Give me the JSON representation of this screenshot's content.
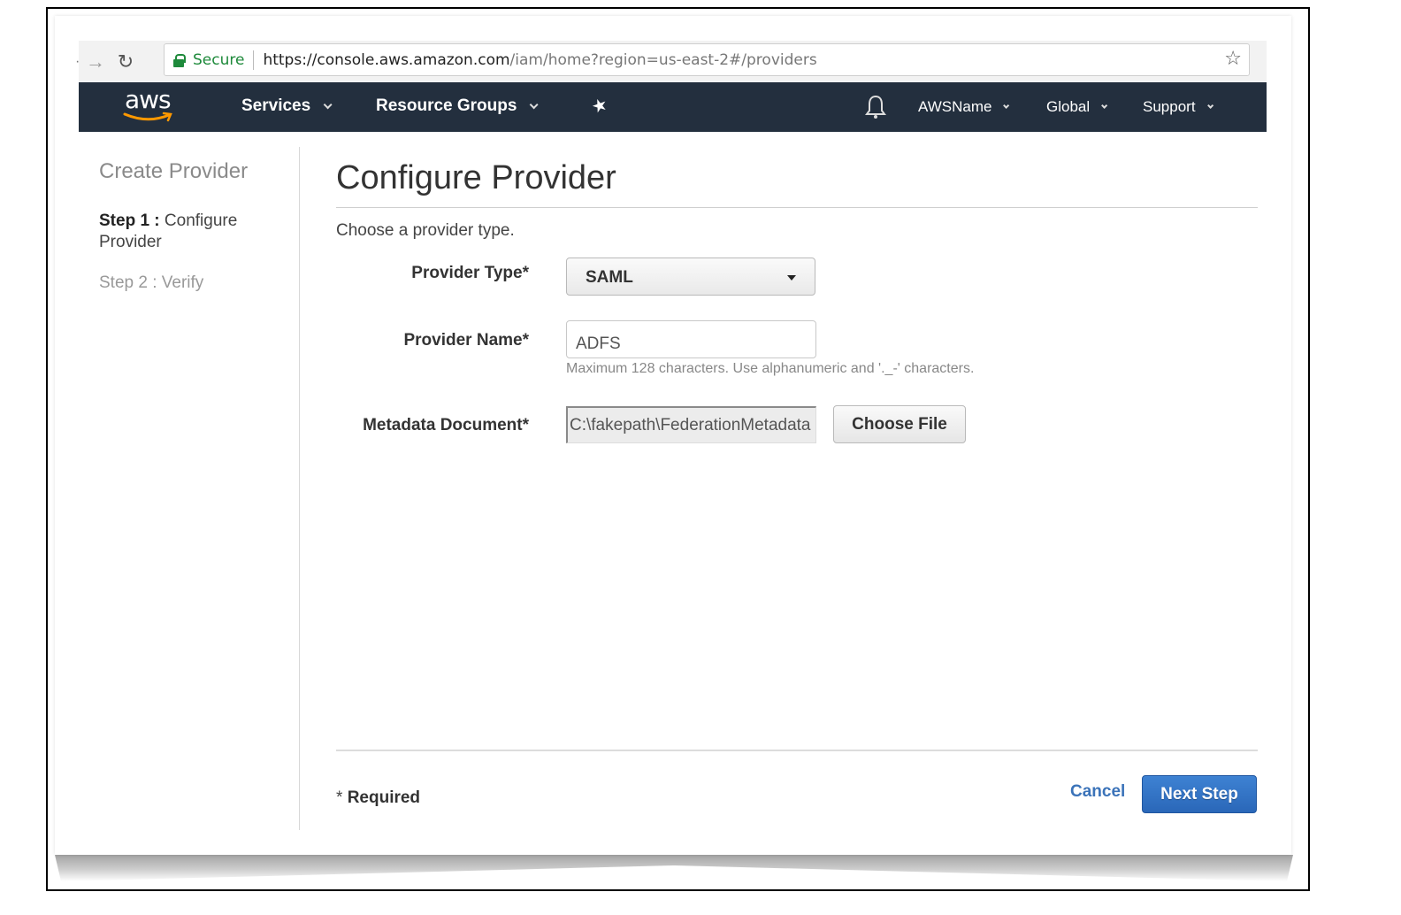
{
  "browser": {
    "secure_label": "Secure",
    "url_host": "https://console.aws.amazon.com",
    "url_path": "/iam/home?region=us-east-2#/providers",
    "icons": {
      "back": "arrow-left",
      "forward": "arrow-right",
      "reload": "reload",
      "lock": "lock",
      "bookmark": "star"
    }
  },
  "aws_nav": {
    "logo_text": "aws",
    "logo_smile_color": "#ff9900",
    "background_color": "#232f3e",
    "services_label": "Services",
    "resource_groups_label": "Resource Groups",
    "pin_icon": "pin",
    "bell_icon": "bell",
    "account_label": "AWSName",
    "region_label": "Global",
    "support_label": "Support"
  },
  "sidebar": {
    "title": "Create Provider",
    "steps": [
      {
        "prefix": "Step 1 :",
        "label": "Configure Provider",
        "active": true
      },
      {
        "prefix": "Step 2 :",
        "label": "Verify",
        "active": false
      }
    ]
  },
  "main": {
    "title": "Configure Provider",
    "intro": "Choose a provider type.",
    "fields": {
      "provider_type": {
        "label": "Provider Type*",
        "value": "SAML"
      },
      "provider_name": {
        "label": "Provider Name*",
        "value": "ADFS",
        "hint": "Maximum 128 characters. Use alphanumeric and '._-' characters."
      },
      "metadata_document": {
        "label": "Metadata Document*",
        "value": "C:\\fakepath\\FederationMetadata",
        "button_label": "Choose File"
      }
    }
  },
  "footer": {
    "required_star": "*",
    "required_label": "Required",
    "cancel_label": "Cancel",
    "next_label": "Next Step",
    "primary_color": "#2f6fc4",
    "link_color": "#3b73b9"
  }
}
